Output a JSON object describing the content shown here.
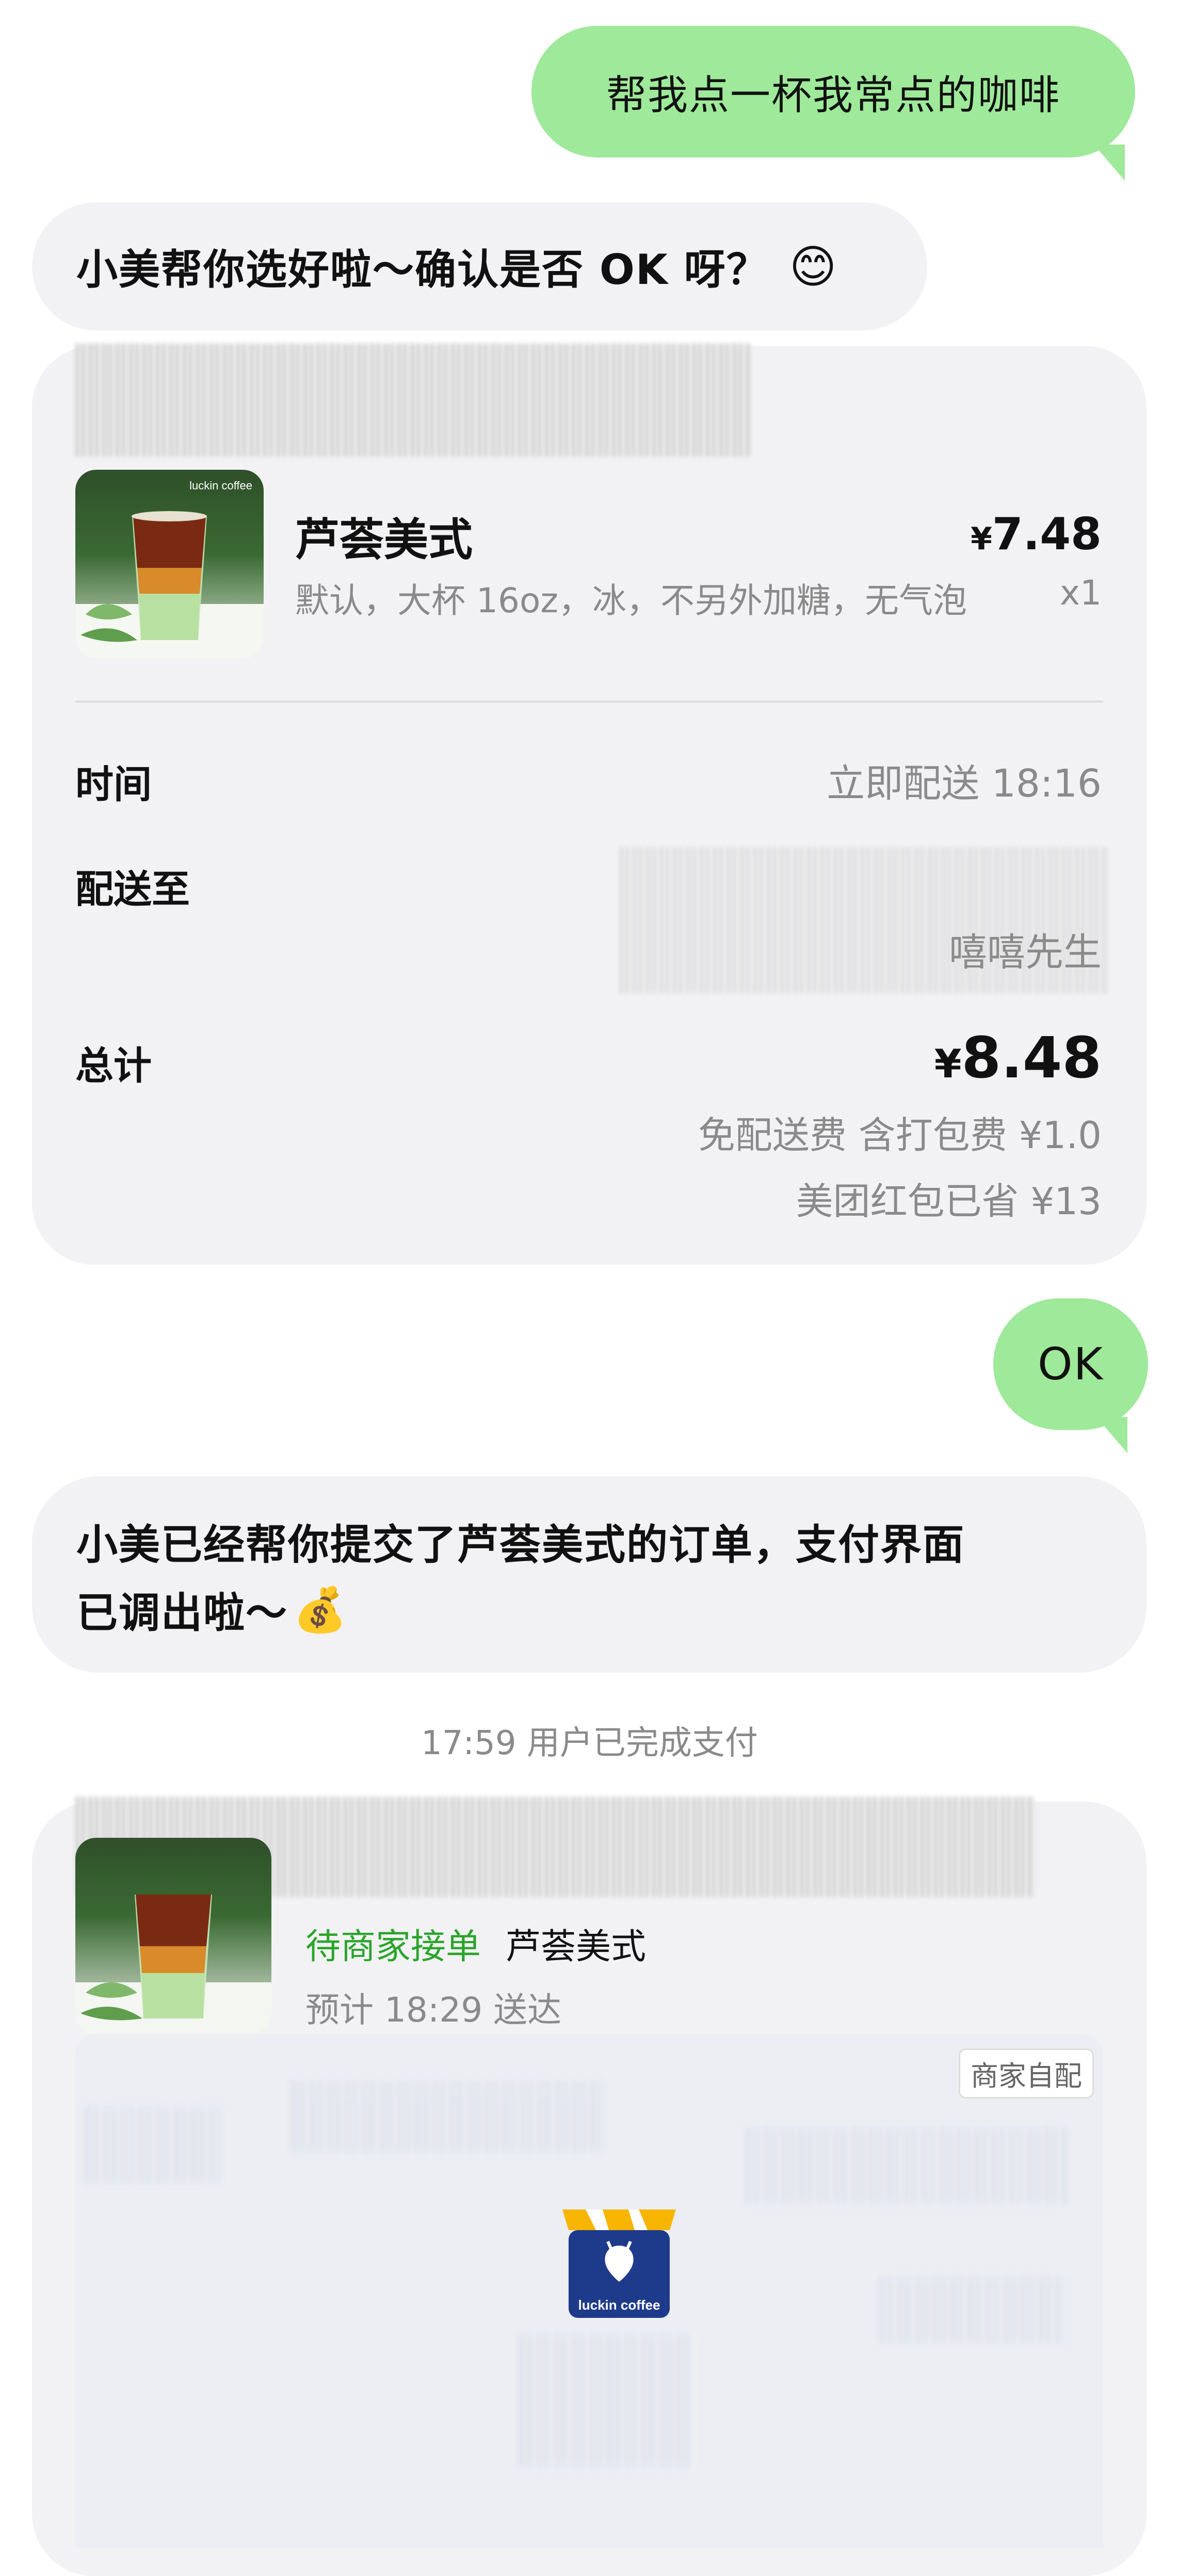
{
  "messages": {
    "user_request": "帮我点一杯我常点的咖啡",
    "assistant_confirm": "小美帮你选好啦～确认是否 OK 呀？",
    "user_ok": "OK",
    "assistant_submitted_line1": "小美已经帮你提交了芦荟美式的订单，支付界面",
    "assistant_submitted_line2": "已调出啦～",
    "system_paid": "17:59 用户已完成支付"
  },
  "order_card": {
    "product_name": "芦荟美式",
    "price_symbol": "¥",
    "price_value": "7.48",
    "options": "默认，大杯 16oz，冰，不另外加糖，无气泡",
    "quantity": "x1",
    "time_label": "时间",
    "time_value": "立即配送 18:16",
    "delivery_label": "配送至",
    "recipient": "嘻嘻先生",
    "total_label": "总计",
    "total_symbol": "¥",
    "total_value": "8.48",
    "fee_note": "免配送费 含打包费 ¥1.0",
    "discount_note": "美团红包已省 ¥13",
    "logo_text": "luckin coffee"
  },
  "status_card": {
    "status": "待商家接单",
    "product_name": "芦荟美式",
    "eta": "预计 18:29 送达",
    "delivery_tag": "商家自配",
    "store_logo_text": "luckin coffee"
  },
  "emoji": {
    "smile": "😊",
    "money_bag": "💰"
  },
  "colors": {
    "user_bubble": "#9ee99a",
    "assistant_bubble": "#f2f2f5",
    "status_green": "#2aa52a",
    "luckin_blue": "#1e3a8a"
  }
}
